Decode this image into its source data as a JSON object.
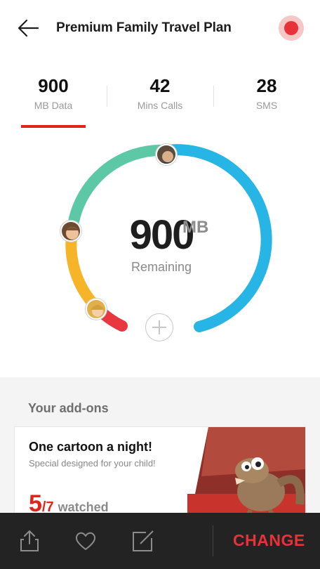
{
  "header": {
    "title": "Premium Family Travel Plan"
  },
  "stats": [
    {
      "value": "900",
      "label": "MB Data"
    },
    {
      "value": "42",
      "label": "Mins Calls"
    },
    {
      "value": "28",
      "label": "SMS"
    }
  ],
  "gauge": {
    "value": "900",
    "unit": "MB",
    "label": "Remaining"
  },
  "addons": {
    "title": "Your add-ons",
    "card": {
      "title": "One cartoon a night!",
      "subtitle": "Special designed for your child!",
      "watched_count": "5",
      "watched_total": "/7",
      "watched_label": "watched"
    }
  },
  "toolbar": {
    "change_label": "CHANGE"
  },
  "colors": {
    "accent": "#e2231a",
    "arc_blue": "#27b5e6",
    "arc_teal": "#5dc8a5",
    "arc_yellow": "#f6b529",
    "arc_red": "#e8373f",
    "toolbar_bg": "#232323"
  }
}
